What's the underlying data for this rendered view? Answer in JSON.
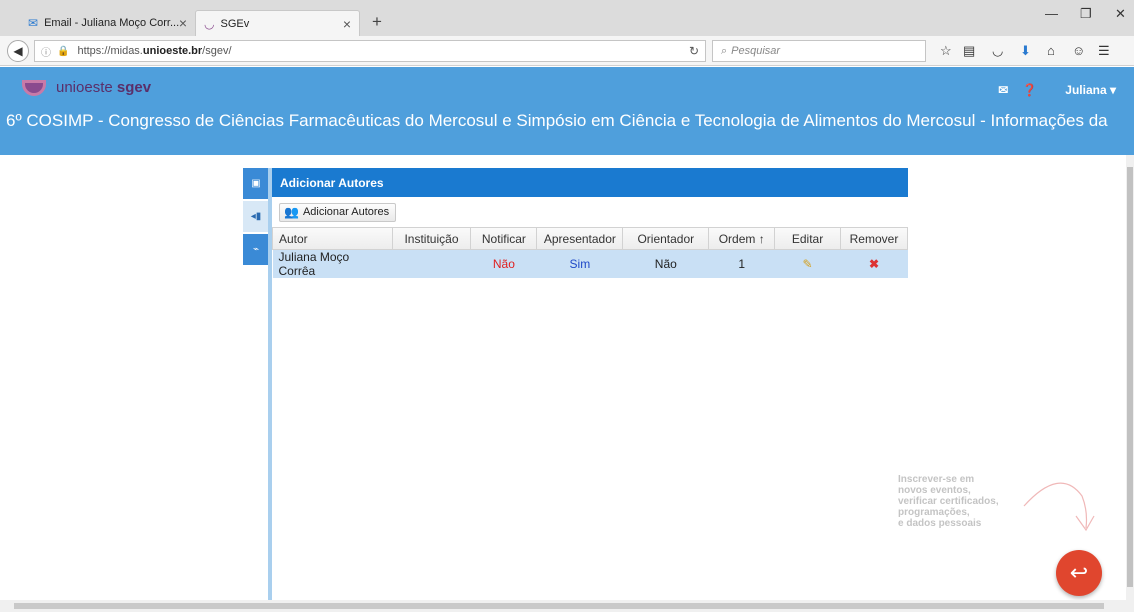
{
  "browser": {
    "tabs": [
      {
        "label": "Email - Juliana Moço Corr...",
        "icon": "mail-icon"
      },
      {
        "label": "SGEv",
        "icon": "unioeste-logo-icon"
      }
    ],
    "url_prefix": "https://midas.",
    "url_domain": "unioeste.br",
    "url_path": "/sgev/",
    "search_placeholder": "Pesquisar"
  },
  "header": {
    "logo_text": "unioeste",
    "logo_bold": "sgev",
    "user": "Juliana",
    "event_title": "6º COSIMP - Congresso de Ciências Farmacêuticas do Mercosul e Simpósio em Ciência e Tecnologia de Alimentos do Mercosul - Informações da"
  },
  "panel": {
    "title": "Adicionar Autores",
    "add_button": "Adicionar Autores",
    "columns": [
      "Autor",
      "Instituição",
      "Notificar",
      "Apresentador",
      "Orientador",
      "Ordem ↑",
      "Editar",
      "Remover"
    ],
    "rows": [
      {
        "autor": "Juliana Moço Corrêa",
        "instituicao": "",
        "notificar": "Não",
        "apresentador": "Sim",
        "orientador": "Não",
        "ordem": "1"
      }
    ]
  },
  "hint": {
    "lines": [
      "Inscrever-se em",
      "novos eventos,",
      "verificar certificados,",
      "programações,",
      "e dados pessoais"
    ]
  },
  "colors": {
    "header_bg": "#4f9fdc",
    "panel_head": "#1a7ad0",
    "row_bg": "#c9e0f5",
    "fab": "#e0462e"
  }
}
